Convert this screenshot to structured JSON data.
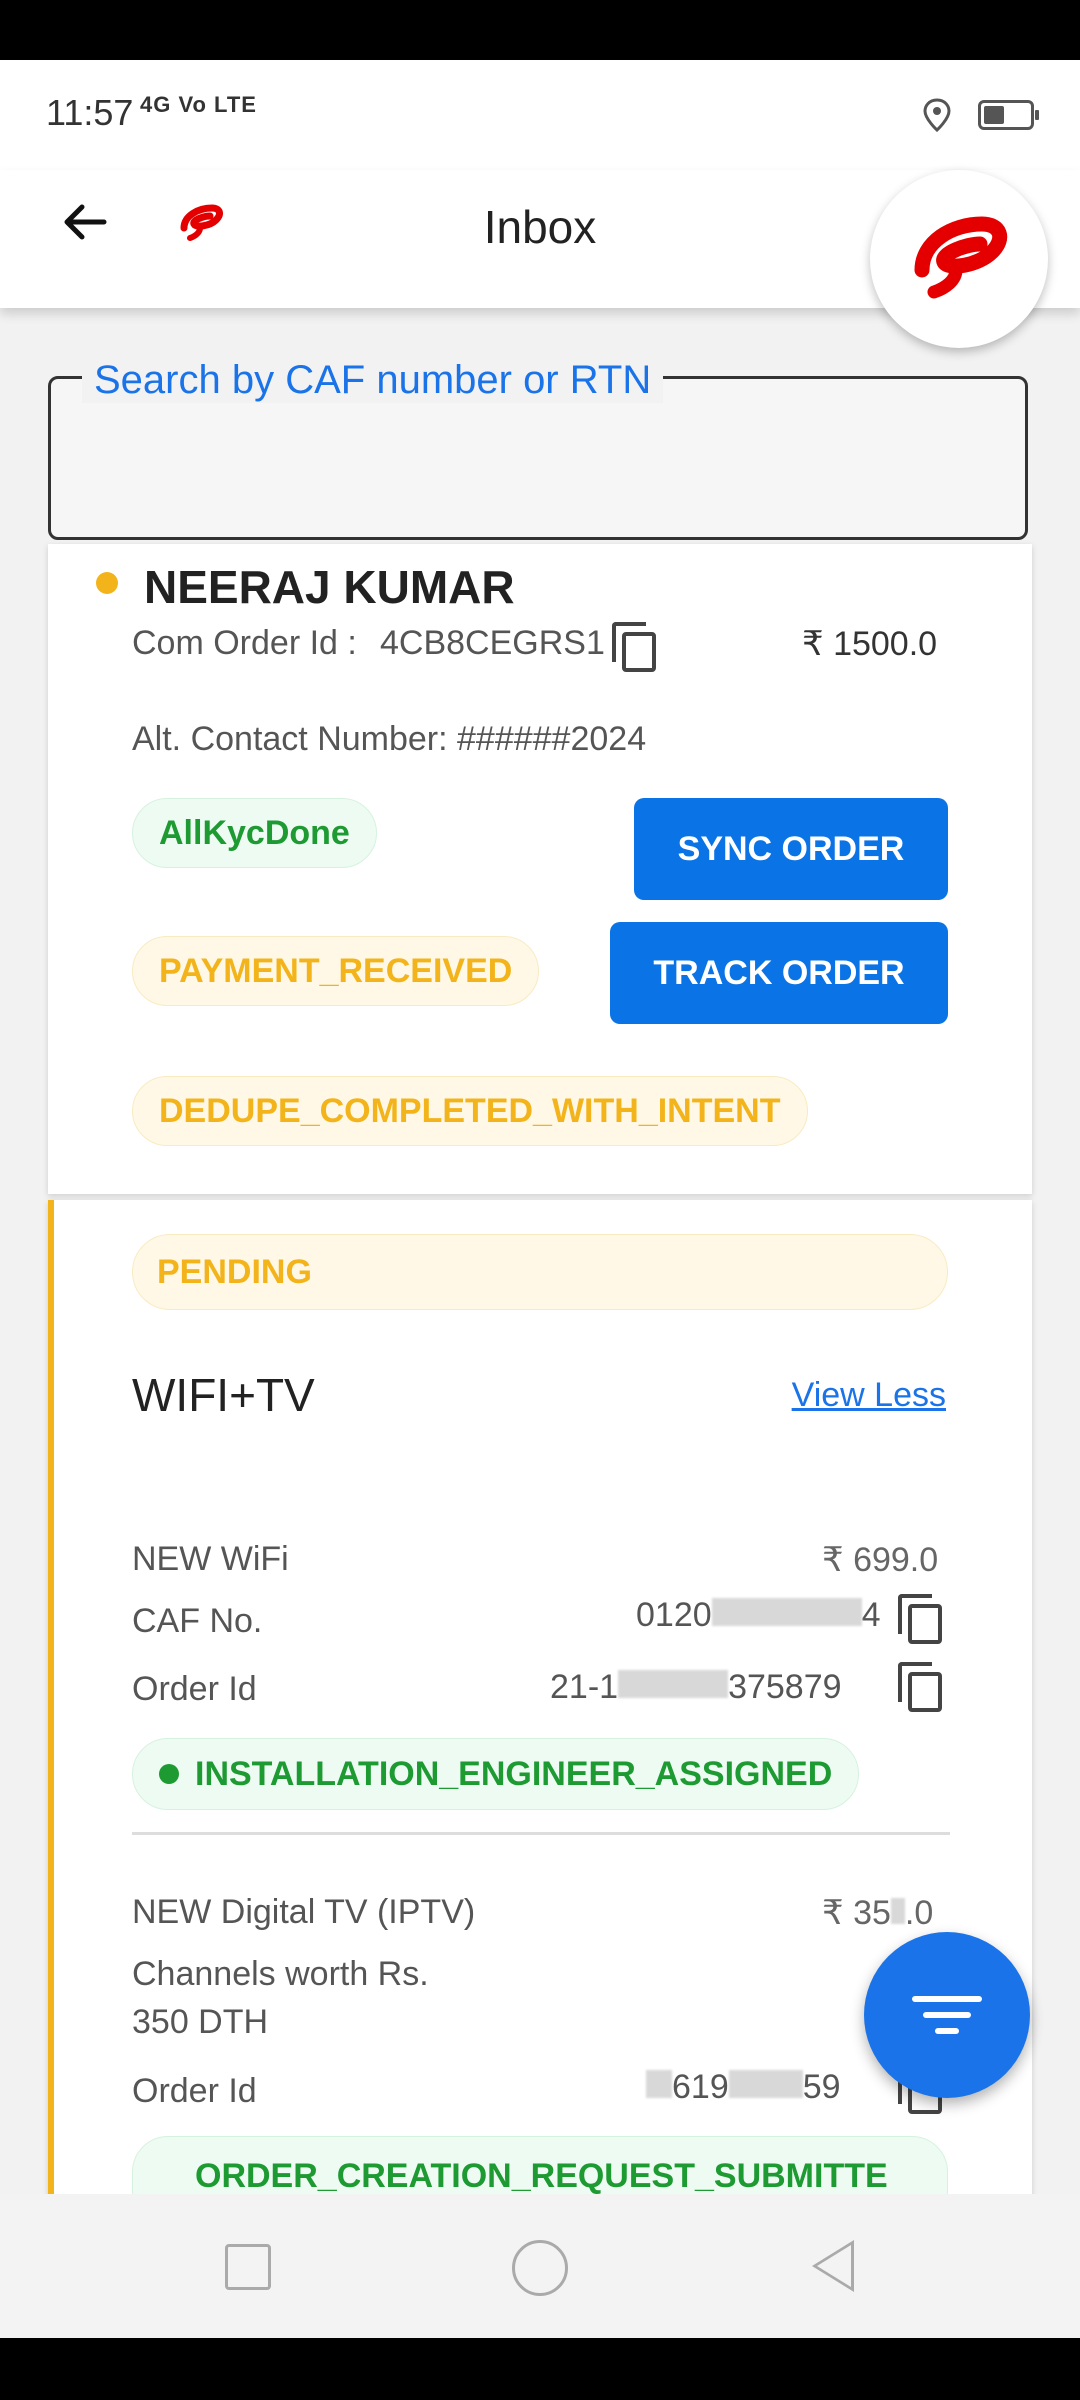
{
  "status": {
    "time": "11:57",
    "network": "4G Vo LTE"
  },
  "appbar": {
    "title": "Inbox"
  },
  "search": {
    "label": "Search by CAF number or RTN",
    "value": ""
  },
  "order": {
    "name": "NEERAJ KUMAR",
    "com_order_label": "Com Order Id :",
    "com_order_id": "4CB8CEGRS1",
    "amount": "₹ 1500.0",
    "alt_contact": "Alt. Contact Number: ######2024",
    "chips": [
      "AllKycDone",
      "PAYMENT_RECEIVED",
      "DEDUPE_COMPLETED_WITH_INTENT"
    ],
    "buttons": {
      "sync": "SYNC ORDER",
      "track": "TRACK ORDER"
    }
  },
  "details": {
    "status": "PENDING",
    "plan_name": "WIFI+TV",
    "toggle": "View Less",
    "item1": {
      "name": "NEW WiFi",
      "price": "₹ 699.0",
      "caf_label": "CAF No.",
      "caf_value_start": "0120",
      "caf_value_end": "4",
      "order_label": "Order Id",
      "order_value_start": "21-1",
      "order_value_end": "375879",
      "status": "INSTALLATION_ENGINEER_ASSIGNED"
    },
    "item2": {
      "name": "NEW Digital TV (IPTV)",
      "price_start": "₹ 35",
      "price_end": ".0",
      "desc_line1": "Channels worth Rs.",
      "desc_line2": "350 DTH",
      "order_label": "Order Id",
      "order_value_start": "619",
      "order_value_end": "59",
      "status": "ORDER_CREATION_REQUEST_SUBMITTE"
    }
  },
  "icons": {
    "back": "arrow-left-icon",
    "brand": "airtel-logo-icon",
    "copy": "copy-icon",
    "filter": "filter-icon",
    "battery": "battery-icon",
    "location": "location-icon"
  },
  "colors": {
    "primary": "#0a73e6",
    "brand_red": "#e40000",
    "success": "#1e9a33",
    "warning": "#f3b41b"
  }
}
